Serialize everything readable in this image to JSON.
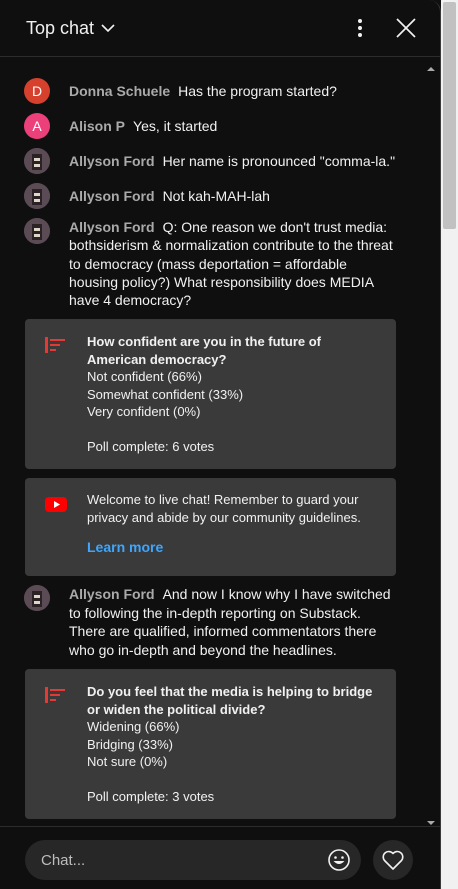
{
  "header": {
    "title": "Top chat"
  },
  "messages": [
    {
      "author": "Donna Schuele",
      "text": "Has the program started?",
      "avatar_letter": "D"
    },
    {
      "author": "Alison P",
      "text": "Yes, it started",
      "avatar_letter": "A"
    },
    {
      "author": "Allyson Ford",
      "text": "Her name is pronounced \"comma-la.\""
    },
    {
      "author": "Allyson Ford",
      "text": "Not kah-MAH-lah"
    },
    {
      "author": "Allyson Ford",
      "text": "Q: One reason we don't trust media: bothsiderism & normalization contribute to the threat to democracy (mass deportation = affordable housing policy?) What responsibility does MEDIA have 4 democracy?"
    },
    {
      "author": "Allyson Ford",
      "text": "And now I know why I have switched to following the in-depth reporting on Substack. There are qualified, informed commentators there who go in-depth and beyond the headlines."
    }
  ],
  "poll1": {
    "question": "How confident are you in the future of American democracy?",
    "options": [
      "Not confident (66%)",
      "Somewhat confident (33%)",
      "Very confident (0%)"
    ],
    "status": "Poll complete: 6 votes"
  },
  "welcome": {
    "text": "Welcome to live chat! Remember to guard your privacy and abide by our community guidelines.",
    "link": "Learn more"
  },
  "poll2": {
    "question": "Do you feel that the media is helping to bridge or widen the political divide?",
    "options": [
      "Widening (66%)",
      "Bridging (33%)",
      "Not sure (0%)"
    ],
    "status": "Poll complete: 3 votes"
  },
  "footer": {
    "placeholder": "Chat..."
  },
  "colors": {
    "accent_link": "#3ea6ff",
    "poll_icon": "#e53935",
    "youtube_red": "#ff0000"
  }
}
